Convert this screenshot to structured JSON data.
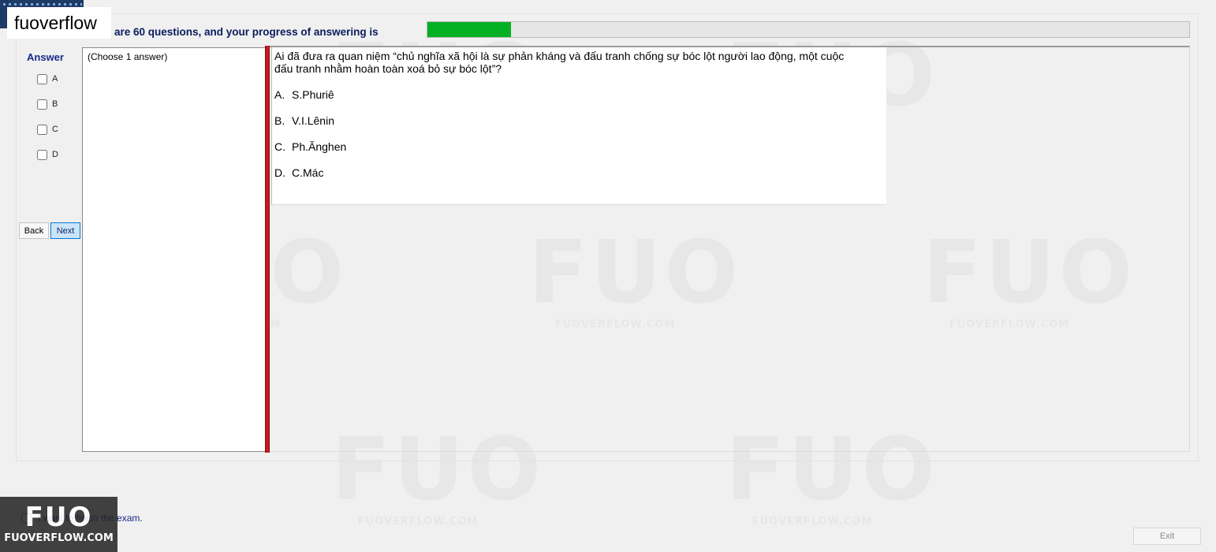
{
  "header": {
    "brand_label": "fuoverflow",
    "progress_text": "are 60 questions, and your progress of answering is",
    "progress_fraction": 0.11
  },
  "answer_panel": {
    "heading": "Answer",
    "options": [
      "A",
      "B",
      "C",
      "D"
    ]
  },
  "nav": {
    "back_label": "Back",
    "next_label": "Next"
  },
  "instruction": {
    "text": "(Choose 1 answer)"
  },
  "question": {
    "text": "Ai đã đưa ra quan niệm “chủ nghĩa xã hội là sự phản kháng và đấu tranh chống sự bóc lột người lao động, một cuộc đấu tranh nhằm hoàn toàn xoá bỏ sự bóc lột”?",
    "options": [
      {
        "letter": "A.",
        "text": "S.Phuriê"
      },
      {
        "letter": "B.",
        "text": "V.I.Lênin"
      },
      {
        "letter": "C.",
        "text": "Ph.Ănghen"
      },
      {
        "letter": "D.",
        "text": "C.Mác"
      }
    ]
  },
  "footer": {
    "finish_label": "I want to finish the exam.",
    "exit_label": "Exit"
  },
  "watermark": {
    "logo": "FUO",
    "site": "FUOVERFLOW.COM"
  },
  "colors": {
    "progress_fill": "#06b025",
    "splitter": "#c8191e",
    "heading_blue": "#1a2a8a"
  }
}
